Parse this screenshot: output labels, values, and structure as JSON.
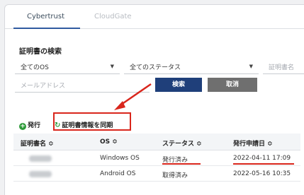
{
  "tabs": [
    {
      "label": "Cybertrust",
      "active": true
    },
    {
      "label": "CloudGate",
      "active": false
    }
  ],
  "search_panel": {
    "title": "証明書の検索",
    "os_select": "全てのOS",
    "status_select": "全てのステータス",
    "cert_name_placeholder": "証明書名",
    "email_placeholder": "メールアドレス",
    "search_label": "検索",
    "cancel_label": "取消"
  },
  "actions": {
    "issue_label": "発行",
    "sync_label": "証明書情報を同期"
  },
  "table": {
    "columns": [
      "証明書名 ≎",
      "OS ≎",
      "ステータス ≎",
      "発行申請日 ≎"
    ],
    "rows": [
      {
        "os": "Windows OS",
        "status": "発行済み",
        "date": "2022-04-11 17:09"
      },
      {
        "os": "Android OS",
        "status": "取得済み",
        "date": "2022-05-16 10:35"
      }
    ]
  },
  "colors": {
    "accent": "#1f3f7a",
    "highlight": "#d9261c",
    "success": "#2e9a3a"
  }
}
